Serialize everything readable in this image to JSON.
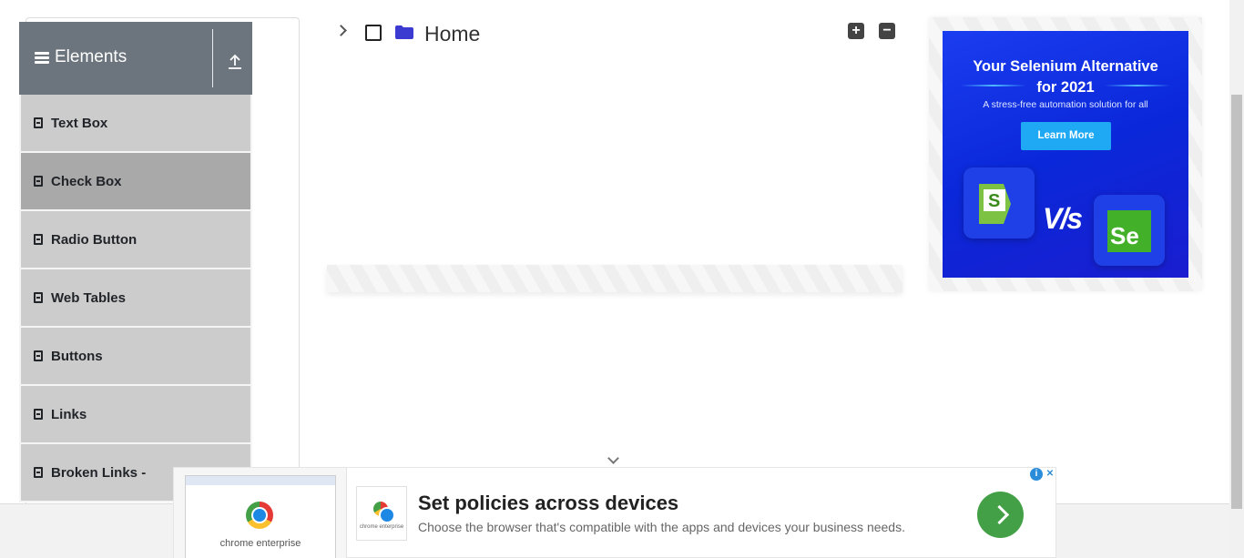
{
  "sidebar": {
    "group_title": "Elements",
    "items": [
      {
        "label": "Text Box"
      },
      {
        "label": "Check Box"
      },
      {
        "label": "Radio Button"
      },
      {
        "label": "Web Tables"
      },
      {
        "label": "Buttons"
      },
      {
        "label": "Links"
      },
      {
        "label": "Broken Links -"
      }
    ],
    "active_item": "Check Box"
  },
  "tree": {
    "root_label": "Home",
    "expand_all_symbol": "+",
    "collapse_all_symbol": "−",
    "checked": false,
    "expanded": false
  },
  "side_ad": {
    "headline_line1": "Your Selenium Alternative",
    "headline_line2": "for 2021",
    "subtext": "A stress-free automation solution for all",
    "cta": "Learn More",
    "vs_text": "V/s",
    "logo_left": "S",
    "logo_right": "Se"
  },
  "bottom_ad": {
    "headline": "Set policies across devices",
    "description": "Choose the browser that's compatible with the apps and devices your business needs.",
    "thumb_caption": "chrome enterprise",
    "thumb_caption_small": "chrome enterprise",
    "info_symbol": "i",
    "close_symbol": "✕"
  },
  "colors": {
    "sidebar_header": "#6c757d",
    "menu_item": "#cccccc",
    "menu_item_active": "#a9a9a9",
    "folder": "#3b3bd1",
    "ad_bg": "#0a28d9",
    "ad_button": "#1fa9f5",
    "go_button": "#43a047"
  }
}
